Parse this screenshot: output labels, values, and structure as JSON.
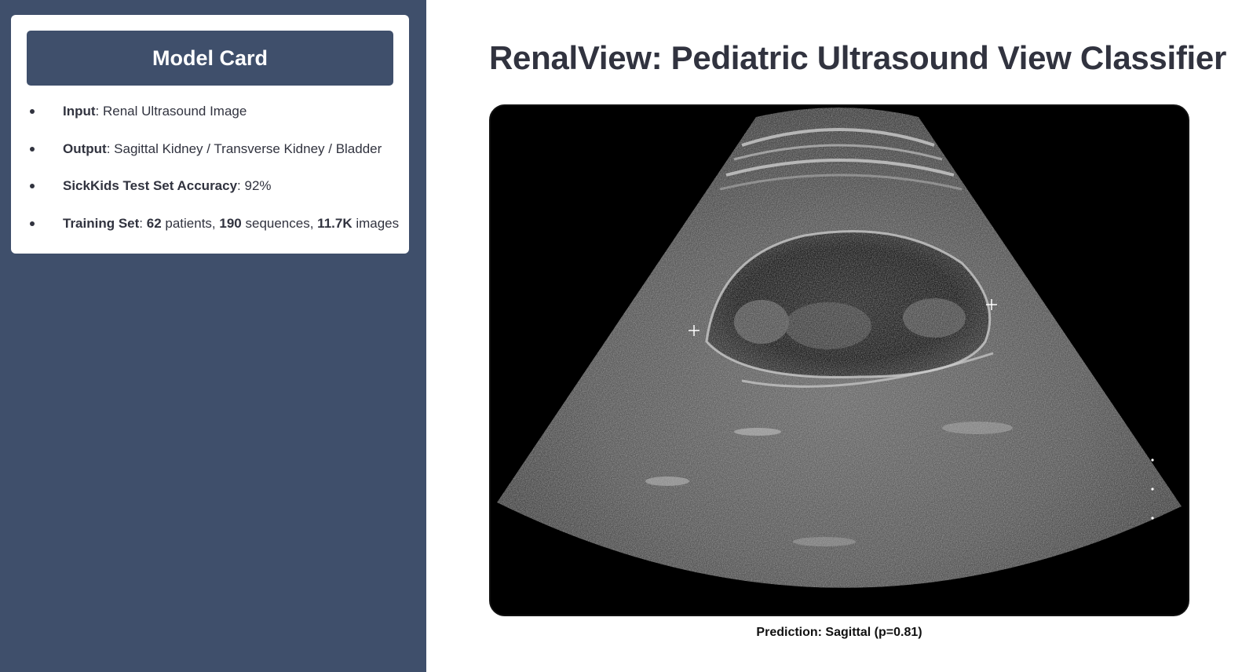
{
  "sidebar": {
    "card_title": "Model Card",
    "items": [
      {
        "label": "Input",
        "sep": ": ",
        "text": "Renal Ultrasound Image"
      },
      {
        "label": "Output",
        "sep": ": ",
        "text": "Sagittal Kidney / Transverse Kidney / Bladder"
      },
      {
        "label": "SickKids Test Set Accuracy",
        "sep": ": ",
        "text": "92%"
      },
      {
        "label": "Training Set",
        "sep": ": ",
        "n1": "62",
        "t1": " patients, ",
        "n2": "190",
        "t2": " sequences, ",
        "n3": "11.7K",
        "t3": " images"
      }
    ]
  },
  "main": {
    "title": "RenalView: Pediatric Ultrasound View Classifier",
    "prediction": "Prediction: Sagittal (p=0.81)"
  },
  "colors": {
    "sidebar_bg": "#3f4f6b",
    "card_bg": "#ffffff",
    "text": "#31333f"
  }
}
